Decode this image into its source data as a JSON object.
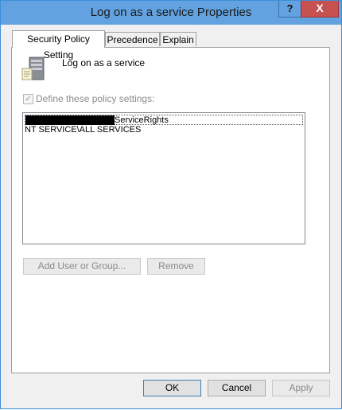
{
  "window": {
    "title": "Log on as a service Properties",
    "help_glyph": "?",
    "close_glyph": "X"
  },
  "tabs": [
    {
      "label": "Security Policy Setting",
      "active": true
    },
    {
      "label": "Precedence",
      "active": false
    },
    {
      "label": "Explain",
      "active": false
    }
  ],
  "policy": {
    "icon": "server-policy-icon",
    "name": "Log on as a service",
    "define_label": "Define these policy settings:",
    "define_checked": true,
    "define_enabled": false
  },
  "accounts": [
    {
      "value": "ServiceRights",
      "redacted_prefix": true,
      "selected": true
    },
    {
      "value": "NT SERVICE\\ALL SERVICES",
      "redacted_prefix": false,
      "selected": false
    }
  ],
  "buttons": {
    "add": "Add User or Group...",
    "remove": "Remove",
    "ok": "OK",
    "cancel": "Cancel",
    "apply": "Apply"
  },
  "colors": {
    "titlebar": "#63a2e0",
    "close_button": "#c75050",
    "dialog_bg": "#f0f0f0"
  }
}
